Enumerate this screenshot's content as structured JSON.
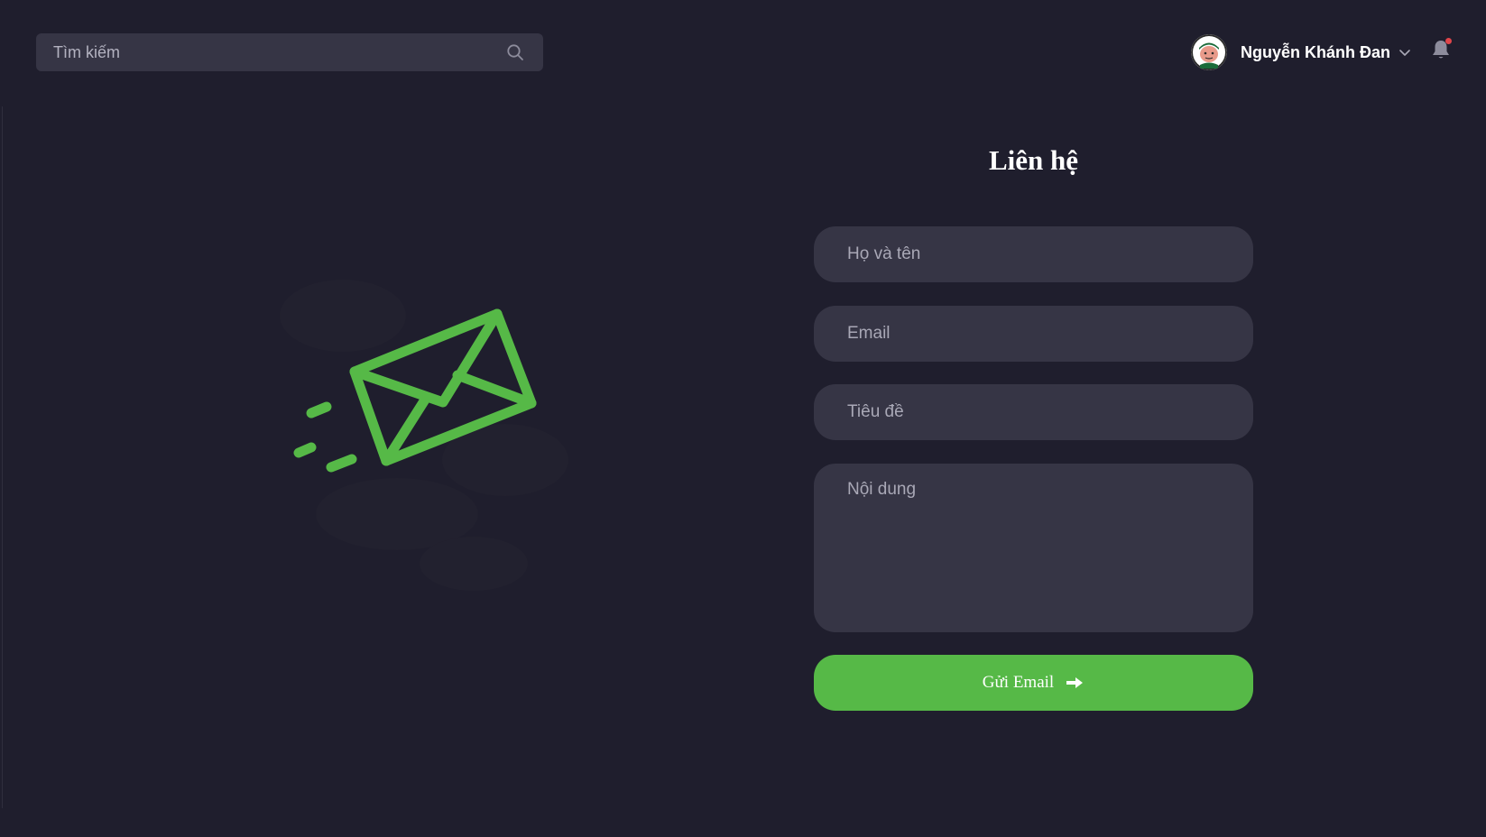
{
  "header": {
    "search": {
      "placeholder": "Tìm kiếm",
      "value": ""
    },
    "user": {
      "name": "Nguyễn Khánh Đan"
    }
  },
  "contact": {
    "title": "Liên hệ",
    "fields": {
      "name_placeholder": "Họ và tên",
      "email_placeholder": "Email",
      "subject_placeholder": "Tiêu đề",
      "content_placeholder": "Nội dung"
    },
    "submit_label": "Gửi Email"
  },
  "colors": {
    "background": "#1f1e2d",
    "field": "#363545",
    "accent": "#56b947",
    "notification_dot": "#e0454a"
  },
  "icons": {
    "search": "search-icon",
    "chevron": "chevron-down-icon",
    "bell": "bell-icon",
    "illustration": "envelope-icon",
    "submit": "arrow-right-icon"
  }
}
